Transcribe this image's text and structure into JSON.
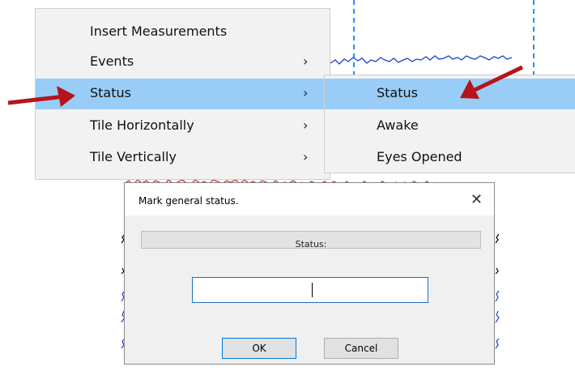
{
  "menu": {
    "items": [
      {
        "label": "Insert Measurements",
        "has_submenu": false
      },
      {
        "label": "Events",
        "has_submenu": true
      },
      {
        "label": "Status",
        "has_submenu": true,
        "highlighted": true
      },
      {
        "label": "Tile Horizontally",
        "has_submenu": true
      },
      {
        "label": "Tile Vertically",
        "has_submenu": true
      }
    ],
    "chevron": "›"
  },
  "submenu": {
    "items": [
      {
        "label": "Status",
        "highlighted": true
      },
      {
        "label": "Awake"
      },
      {
        "label": "Eyes Opened"
      }
    ]
  },
  "dialog": {
    "title": "Mark general status.",
    "close_glyph": "✕",
    "header_label": "Status:",
    "input_value": "",
    "ok_label": "OK",
    "cancel_label": "Cancel"
  },
  "colors": {
    "highlight": "#99cdf7",
    "annotation_arrow": "#b5141a",
    "eeg_blue": "#1f3fd1",
    "eeg_red": "#c0281e",
    "marker_dash": "#1e90ff"
  },
  "icons": {
    "submenu_chevron": "chevron-right-icon",
    "close": "close-icon",
    "annotation_arrows": "red-arrow-icon"
  }
}
